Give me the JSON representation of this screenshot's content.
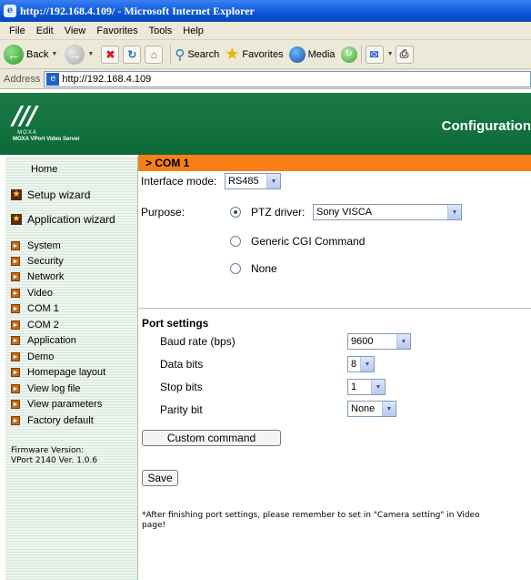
{
  "window": {
    "title": "http://192.168.4.109/ - Microsoft Internet Explorer"
  },
  "menu": [
    "File",
    "Edit",
    "View",
    "Favorites",
    "Tools",
    "Help"
  ],
  "toolbar": {
    "back": "Back",
    "search": "Search",
    "favorites": "Favorites",
    "media": "Media"
  },
  "address": {
    "label": "Address",
    "url": "http://192.168.4.109"
  },
  "header": {
    "logo_brand": "MOXA",
    "logo_sub": "MOXA VPort Video Server",
    "config_title": "Configuration",
    "section": "> COM 1"
  },
  "sidebar": {
    "home": "Home",
    "setup_wizard": "Setup wizard",
    "application_wizard": "Application wizard",
    "items": [
      "System",
      "Security",
      "Network",
      "Video",
      "COM 1",
      "COM 2",
      "Application",
      "Demo",
      "Homepage layout",
      "View log file",
      "View parameters",
      "Factory default"
    ],
    "firmware_label": "Firmware Version:",
    "firmware_version": "VPort 2140 Ver. 1.0.6"
  },
  "form": {
    "interface_mode_label": "Interface mode:",
    "interface_mode": "RS485",
    "purpose_label": "Purpose:",
    "ptz_label": "PTZ driver:",
    "ptz_driver": "Sony VISCA",
    "generic_cgi": "Generic CGI Command",
    "none": "None",
    "selected_purpose": "ptz"
  },
  "port_settings": {
    "title": "Port settings",
    "baud_label": "Baud rate (bps)",
    "baud": "9600",
    "data_bits_label": "Data bits",
    "data_bits": "8",
    "stop_bits_label": "Stop bits",
    "stop_bits": "1",
    "parity_label": "Parity bit",
    "parity": "None"
  },
  "buttons": {
    "custom_command": "Custom command",
    "save": "Save"
  },
  "note": "*After finishing port settings, please remember to set in \"Camera setting\" in Video page!",
  "colors": {
    "header_green": "#0b6a37",
    "section_orange": "#f77f18",
    "titlebar_blue": "#0a55d6"
  }
}
